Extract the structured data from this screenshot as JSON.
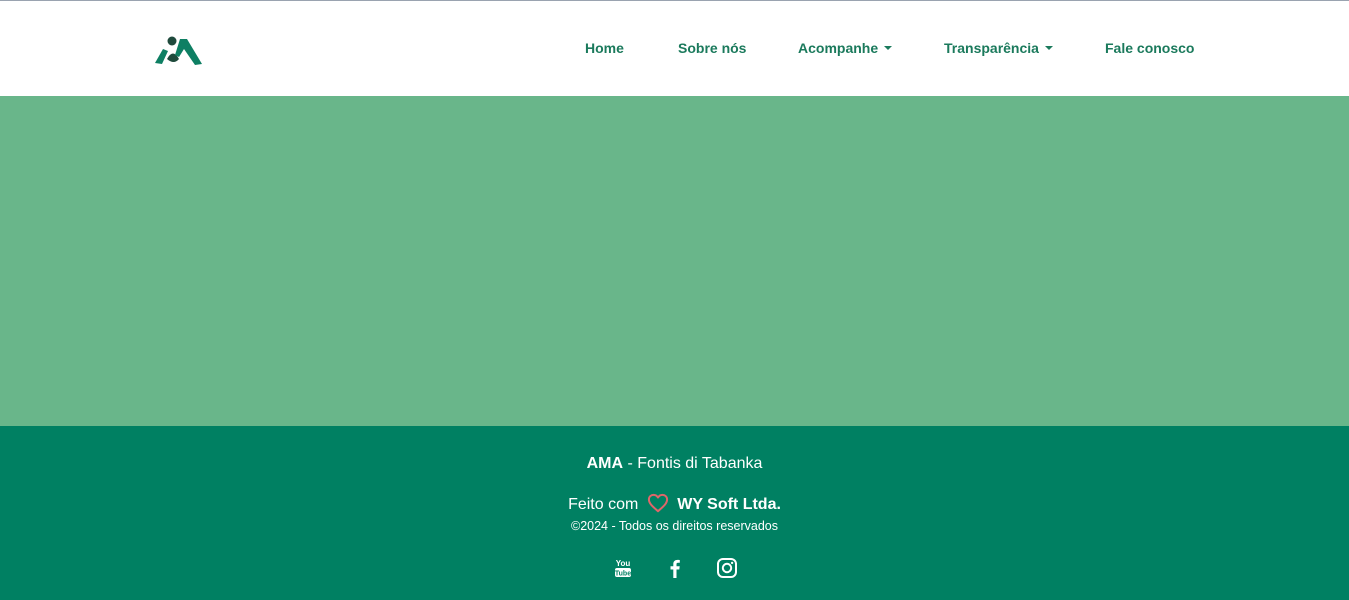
{
  "header": {
    "logo_icon": "ama-logo-icon",
    "nav": [
      {
        "label": "Home",
        "has_dropdown": false
      },
      {
        "label": "Sobre nós",
        "has_dropdown": false
      },
      {
        "label": "Acompanhe",
        "has_dropdown": true
      },
      {
        "label": "Transparência",
        "has_dropdown": true
      },
      {
        "label": "Fale conosco",
        "has_dropdown": false
      }
    ]
  },
  "footer": {
    "brand": "AMA",
    "brand_suffix": " - Fontis di Tabanka",
    "made_with_prefix": "Feito com",
    "made_with_icon": "heart-icon",
    "made_by": "WY Soft Ltda.",
    "copyright": "©2024 - Todos os direitos reservados",
    "social_icons": [
      "youtube-icon",
      "facebook-icon",
      "instagram-icon"
    ]
  },
  "colors": {
    "nav_text": "#1b7a5c",
    "hero_bg": "#69b68a",
    "footer_bg": "#008062",
    "heart": "#e0666a",
    "logo": "#0e7f63"
  }
}
